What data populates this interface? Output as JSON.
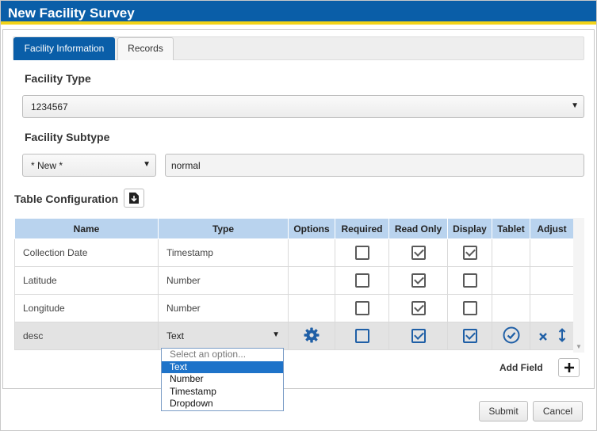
{
  "title": "New Facility Survey",
  "tabs": [
    {
      "label": "Facility Information",
      "active": true
    },
    {
      "label": "Records",
      "active": false
    }
  ],
  "facility_type": {
    "label": "Facility Type",
    "value": "1234567"
  },
  "facility_subtype": {
    "label": "Facility Subtype",
    "select_value": "* New *",
    "input_value": "normal"
  },
  "table_config": {
    "label": "Table Configuration",
    "export_icon": "download-file-icon",
    "columns": [
      "Name",
      "Type",
      "Options",
      "Required",
      "Read Only",
      "Display",
      "Tablet",
      "Adjust"
    ],
    "rows": [
      {
        "name": "Collection Date",
        "type": "Timestamp",
        "required": false,
        "read_only": true,
        "display": true
      },
      {
        "name": "Latitude",
        "type": "Number",
        "required": false,
        "read_only": true,
        "display": false
      },
      {
        "name": "Longitude",
        "type": "Number",
        "required": false,
        "read_only": true,
        "display": false
      },
      {
        "name": "desc",
        "type": "Text",
        "required": false,
        "read_only": true,
        "display": true,
        "selected": true
      }
    ]
  },
  "type_dropdown": {
    "placeholder": "Select an option...",
    "options": [
      "Text",
      "Number",
      "Timestamp",
      "Dropdown"
    ],
    "highlighted": "Text"
  },
  "add_field": {
    "label": "Add Field",
    "icon": "plus-icon"
  },
  "footer": {
    "submit": "Submit",
    "cancel": "Cancel"
  },
  "colors": {
    "brand": "#0a5ea8",
    "accent": "#f2d318",
    "header": "#b9d3ee",
    "highlight": "#1e73c9"
  }
}
